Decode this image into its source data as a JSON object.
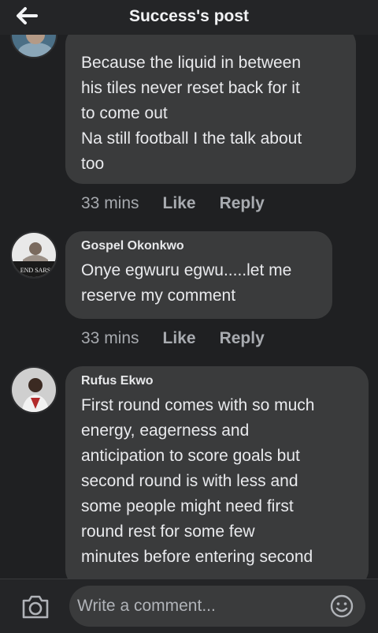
{
  "header": {
    "title": "Success's post"
  },
  "comments": [
    {
      "author": "",
      "lines": [
        "Because the liquid in between",
        "his tiles never reset back for it",
        "to come out",
        "Na still football I the talk about",
        "too"
      ],
      "time": "33 mins",
      "like_label": "Like",
      "reply_label": "Reply"
    },
    {
      "author": "Gospel Okonkwo",
      "avatar_text": "END SARS",
      "lines": [
        "Onye egwuru egwu.....let me",
        "reserve my comment"
      ],
      "time": "33 mins",
      "like_label": "Like",
      "reply_label": "Reply"
    },
    {
      "author": "Rufus Ekwo",
      "lines": [
        "First round comes with so much",
        "energy, eagerness and",
        "anticipation to score goals but",
        "second round is with less and",
        "some people might need first",
        "round rest for some few",
        "minutes before entering second"
      ]
    }
  ],
  "composer": {
    "placeholder": "Write a comment..."
  },
  "icons": {
    "back": "back-arrow-icon",
    "camera": "camera-icon",
    "emoji": "emoji-icon"
  },
  "colors": {
    "background": "#1f2022",
    "bubble": "#3a3b3c",
    "text": "#e9eaed",
    "muted": "#a6a9ae"
  }
}
